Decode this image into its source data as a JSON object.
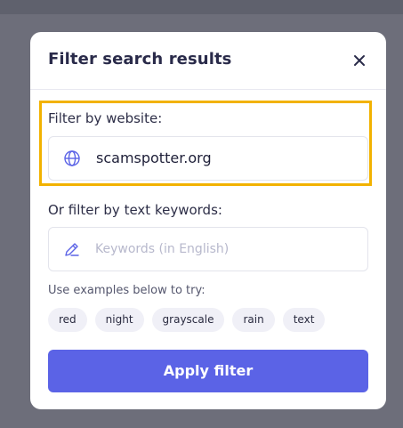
{
  "modal": {
    "title": "Filter search results"
  },
  "website_filter": {
    "label": "Filter by website:",
    "value": "scamspotter.org",
    "icon": "globe-icon"
  },
  "keyword_filter": {
    "label": "Or filter by text keywords:",
    "placeholder": "Keywords (in English)",
    "icon": "pencil-icon"
  },
  "examples": {
    "label": "Use examples below to try:",
    "items": [
      "red",
      "night",
      "grayscale",
      "rain",
      "text"
    ]
  },
  "actions": {
    "apply_label": "Apply filter"
  },
  "colors": {
    "accent": "#5b63e6",
    "highlight_border": "#f2b200",
    "overlay": "#6d6e7a"
  }
}
